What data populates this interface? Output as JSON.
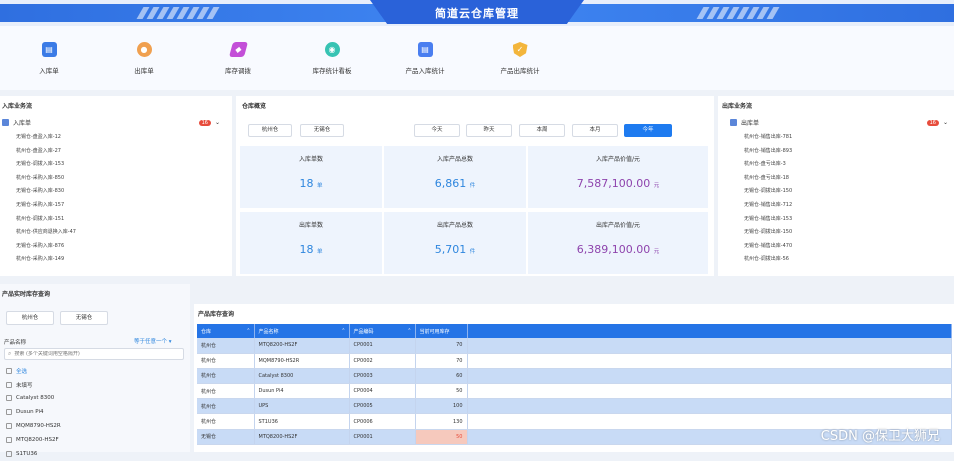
{
  "header": {
    "title": "简道云仓库管理"
  },
  "toolbar": [
    {
      "label": "入库单",
      "icon": "inbound-doc-icon",
      "color": "#3b7be6"
    },
    {
      "label": "出库单",
      "icon": "outbound-doc-icon",
      "color": "#f0a050"
    },
    {
      "label": "库存调拨",
      "icon": "transfer-icon",
      "color": "#c34fd8"
    },
    {
      "label": "库存统计看板",
      "icon": "dashboard-icon",
      "color": "#37c3b3"
    },
    {
      "label": "产品入库统计",
      "icon": "inbound-stats-icon",
      "color": "#4a7ef0"
    },
    {
      "label": "产品出库统计",
      "icon": "outbound-stats-icon",
      "color": "#f3b53c"
    }
  ],
  "inbound_flow": {
    "title": "入库业务流",
    "group_label": "入库单",
    "badge": "16",
    "items": [
      "无锡仓-盘盈入库-12",
      "杭州仓-盘盈入库-27",
      "无锡仓-调拨入库-153",
      "杭州仓-采购入库-850",
      "无锡仓-采购入库-830",
      "无锡仓-采购入库-157",
      "杭州仓-调拨入库-151",
      "杭州仓-供应商退换入库-47",
      "无锡仓-采购入库-876",
      "杭州仓-采购入库-149"
    ]
  },
  "warehouse_stats": {
    "title": "仓库概览",
    "warehouses": [
      "杭州仓",
      "无锡仓"
    ],
    "periods": [
      "今天",
      "昨天",
      "本周",
      "本月",
      "今年"
    ],
    "active_period": "今年",
    "cards": [
      {
        "label": "入库单数",
        "value": "18",
        "unit": "单",
        "color": "#2e86de"
      },
      {
        "label": "入库产品总数",
        "value": "6,861",
        "unit": "件",
        "color": "#2e86de"
      },
      {
        "label": "入库产品价值/元",
        "value": "7,587,100.00",
        "unit": "元",
        "color": "#8e44ad"
      },
      {
        "label": "出库单数",
        "value": "18",
        "unit": "单",
        "color": "#2e86de"
      },
      {
        "label": "出库产品总数",
        "value": "5,701",
        "unit": "件",
        "color": "#2e86de"
      },
      {
        "label": "出库产品价值/元",
        "value": "6,389,100.00",
        "unit": "元",
        "color": "#8e44ad"
      }
    ]
  },
  "outbound_flow": {
    "title": "出库业务流",
    "group_label": "出库单",
    "badge": "16",
    "items": [
      "杭州仓-销售出库-781",
      "杭州仓-销售出库-893",
      "杭州仓-盘亏出库-3",
      "杭州仓-盘亏出库-18",
      "无锡仓-调拨出库-150",
      "无锡仓-销售出库-712",
      "无锡仓-销售出库-153",
      "无锡仓-调拨出库-150",
      "无锡仓-销售出库-470",
      "杭州仓-调拨出库-56"
    ]
  },
  "inventory_query": {
    "title": "产品实时库存查询",
    "warehouses": [
      "杭州仓",
      "无锡仓"
    ],
    "product_name_label": "产品名称",
    "match_label": "等于任意一个",
    "search_placeholder": "搜索 (多个关键词用空格隔开)",
    "options": [
      "全选",
      "未填写",
      "Catalyst 8300",
      "Dusun Pi4",
      "MQM8790-HS2R",
      "MTQ8200-HS2F",
      "S1TU36"
    ]
  },
  "inventory_table": {
    "title": "产品库存查询",
    "columns": [
      "仓库",
      "产品名称",
      "产品编码",
      "当前可用库存"
    ],
    "rows": [
      [
        "杭州仓",
        "MTQ8200-HS2F",
        "CP0001",
        "70"
      ],
      [
        "杭州仓",
        "MQM8790-HS2R",
        "CP0002",
        "70"
      ],
      [
        "杭州仓",
        "Catalyst 8300",
        "CP0003",
        "60"
      ],
      [
        "杭州仓",
        "Dusun Pi4",
        "CP0004",
        "50"
      ],
      [
        "杭州仓",
        "UPS",
        "CP0005",
        "100"
      ],
      [
        "杭州仓",
        "ST1U36",
        "CP0006",
        "130"
      ],
      [
        "无锡仓",
        "MTQ8200-HS2F",
        "CP0001",
        "50"
      ]
    ]
  },
  "watermark": "CSDN @保卫大狮兄"
}
